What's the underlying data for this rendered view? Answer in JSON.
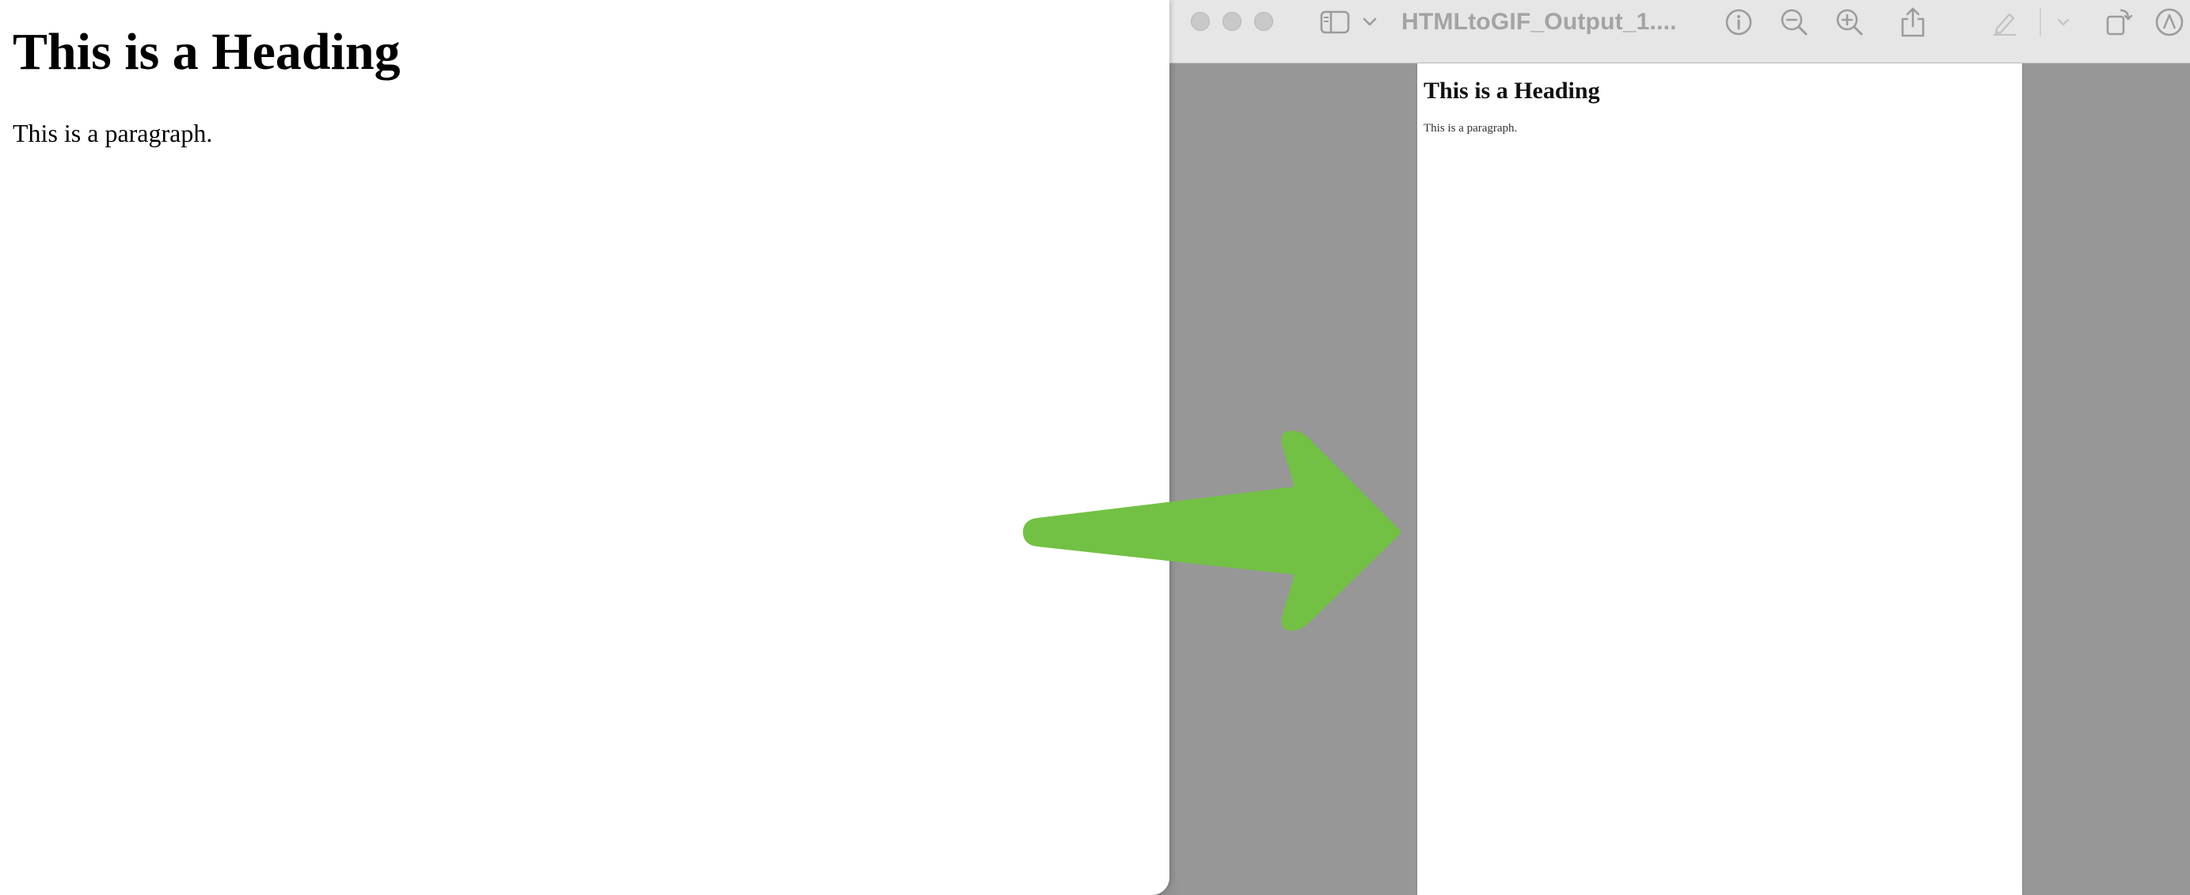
{
  "browser_page": {
    "heading": "This is a Heading",
    "paragraph": "This is a paragraph."
  },
  "viewer": {
    "document_title": "HTMLtoGIF_Output_1....",
    "toolbar": {
      "icons": [
        "sidebar-icon",
        "chevron-down-icon",
        "info-icon",
        "zoom-out-icon",
        "zoom-in-icon",
        "share-icon",
        "markup-pen-icon",
        "chevron-down-icon",
        "rotate-icon",
        "annotate-icon"
      ]
    },
    "page": {
      "heading": "This is a Heading",
      "paragraph": "This is a paragraph."
    }
  },
  "colors": {
    "arrow": "#72c144",
    "viewer_background": "#979797",
    "toolbar_background": "#e6e6e6",
    "toolbar_icon": "#9c9c9c"
  }
}
